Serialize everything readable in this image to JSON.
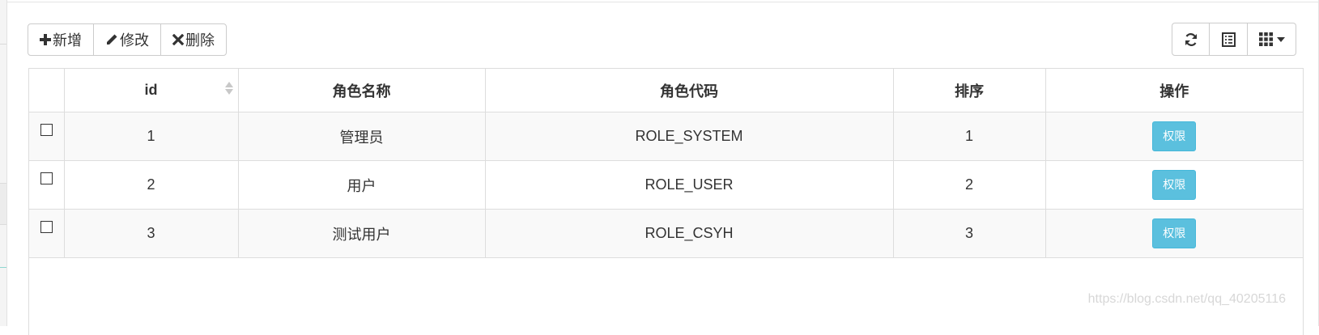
{
  "toolbar": {
    "add_label": "新增",
    "edit_label": "修改",
    "delete_label": "删除",
    "add_icon": "plus-icon",
    "edit_icon": "pencil-icon",
    "delete_icon": "close-icon",
    "refresh_icon": "refresh-icon",
    "toggle_view_icon": "list-alt-icon",
    "columns_icon": "grid-icon"
  },
  "table": {
    "headers": [
      "id",
      "角色名称",
      "角色代码",
      "排序",
      "操作"
    ],
    "rows": [
      {
        "id": "1",
        "name": "管理员",
        "code": "ROLE_SYSTEM",
        "sort": "1",
        "action": "权限"
      },
      {
        "id": "2",
        "name": "用户",
        "code": "ROLE_USER",
        "sort": "2",
        "action": "权限"
      },
      {
        "id": "3",
        "name": "测试用户",
        "code": "ROLE_CSYH",
        "sort": "3",
        "action": "权限"
      }
    ]
  },
  "watermark": "https://blog.csdn.net/qq_40205116",
  "colors": {
    "info_button": "#5bc0de",
    "border": "#dddddd",
    "striped_row": "#f9f9f9"
  }
}
